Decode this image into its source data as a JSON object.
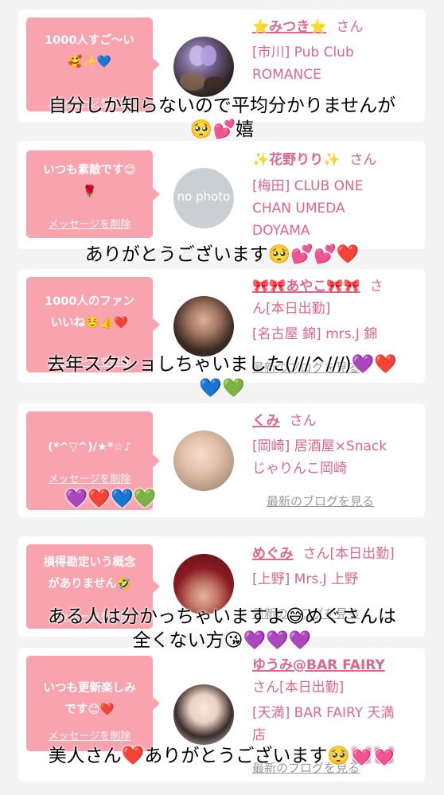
{
  "colors": {
    "bubble": "#f9a3ae",
    "name_text": "#e2658a",
    "link_grey": "#999999",
    "background": "#f4f4f4"
  },
  "delete_label": "メッセージを削除",
  "blog_label": "最新のブログを見る",
  "cards": [
    {
      "message": "1000人すご〜い\n🥰✨💙",
      "name": "⭐みつき⭐",
      "san": "さん",
      "shop": "[市川] Pub Club\nROMANCE",
      "avatar_icon": "butterfly-photo"
    },
    {
      "message": "いつも素敵です😊\n🌹",
      "name": "✨花野りり✨",
      "san": "さん",
      "shop": "[梅田] CLUB ONE\nCHAN UMEDA\nDOYAMA",
      "avatar_text": "no photo"
    },
    {
      "message": "1000人のファン\nいいね☺️👍❤️",
      "name": "🎀🎀あやこ🎀🎀",
      "san": "さ",
      "status": "ん[本日出勤]",
      "shop": "[名古屋 錦] mrs.J 錦"
    },
    {
      "message": "(*^▽^)/★*☆♪",
      "name": "くみ",
      "san": "さん",
      "shop": "[岡崎] 居酒屋×Snack\nじゃりんこ岡崎"
    },
    {
      "message": "損得勘定いう概念\nがありません🤣",
      "name": "めぐみ",
      "san": "さん[本日出勤]",
      "shop": "[上野] Mrs.J 上野"
    },
    {
      "message": "いつも更新楽しみ\nです😊❤️",
      "name": "ゆうみ@BAR FAIRY",
      "san": "",
      "status": "さん[本日出勤]",
      "shop": "[天満] BAR FAIRY 天満\n店"
    }
  ],
  "captions": [
    "自分しか知らないので平均分かりませんが\n🥺💕嬉",
    "ありがとうございます🥺💕💕❤️",
    "去年スクショしちゃいました(///^///)💜❤️\n💙💚",
    "💜❤️💙💚",
    "ある人は分かっちゃいますよ😅めぐさんは\n全くない方😘💜💜💜",
    "美人さん❤️ありがとうございます🥺💓💓"
  ]
}
